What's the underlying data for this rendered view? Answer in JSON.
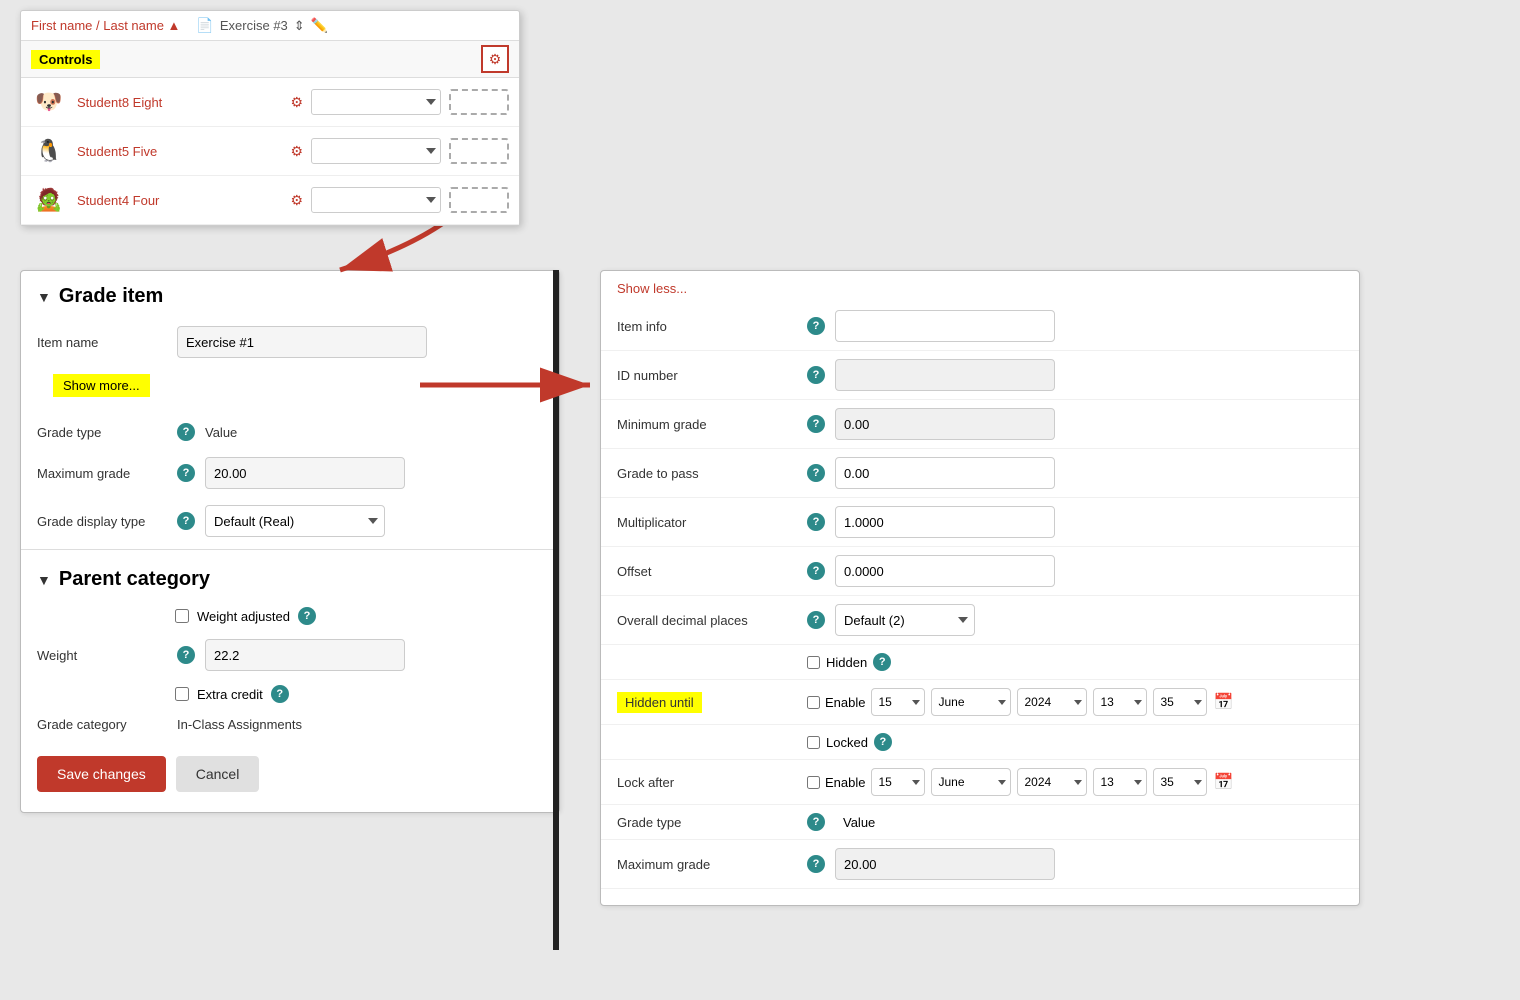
{
  "gradebook": {
    "col_name": "First name / Last name ▲",
    "exercise_label": "Exercise #3",
    "controls_label": "Controls",
    "students": [
      {
        "name": "Student8 Eight",
        "avatar": "🐶"
      },
      {
        "name": "Student5 Five",
        "avatar": "🐧"
      },
      {
        "name": "Student4 Four",
        "avatar": "🧟"
      }
    ]
  },
  "left_panel": {
    "grade_item_title": "Grade item",
    "item_name_label": "Item name",
    "item_name_value": "Exercise #1",
    "show_more_label": "Show more...",
    "grade_type_label": "Grade type",
    "grade_type_value": "Value",
    "max_grade_label": "Maximum grade",
    "max_grade_value": "20.00",
    "grade_display_label": "Grade display type",
    "grade_display_value": "Default (Real)",
    "parent_category_title": "Parent category",
    "weight_adjusted_label": "Weight adjusted",
    "weight_label": "Weight",
    "weight_value": "22.2",
    "extra_credit_label": "Extra credit",
    "grade_category_label": "Grade category",
    "grade_category_value": "In-Class Assignments",
    "save_label": "Save changes",
    "cancel_label": "Cancel"
  },
  "right_panel": {
    "show_less_label": "Show less...",
    "item_info_label": "Item info",
    "item_info_value": "",
    "id_number_label": "ID number",
    "id_number_value": "",
    "min_grade_label": "Minimum grade",
    "min_grade_value": "0.00",
    "grade_to_pass_label": "Grade to pass",
    "grade_to_pass_value": "0.00",
    "multiplicator_label": "Multiplicator",
    "multiplicator_value": "1.0000",
    "offset_label": "Offset",
    "offset_value": "0.0000",
    "overall_decimal_label": "Overall decimal places",
    "overall_decimal_value": "Default (2)",
    "hidden_label": "Hidden",
    "hidden_until_badge": "Hidden until",
    "enable_label": "Enable",
    "day_value": "15",
    "month_value": "June",
    "year_value": "2024",
    "hour_value": "13",
    "min_value": "35",
    "locked_label": "Locked",
    "lock_after_label": "Lock after",
    "lock_enable_label": "Enable",
    "lock_day_value": "15",
    "lock_month_value": "June",
    "lock_year_value": "2024",
    "lock_hour_value": "13",
    "lock_min_value": "35",
    "grade_type_label": "Grade type",
    "grade_type_value": "Value",
    "max_grade_label": "Maximum grade",
    "max_grade_value": "20.00"
  }
}
